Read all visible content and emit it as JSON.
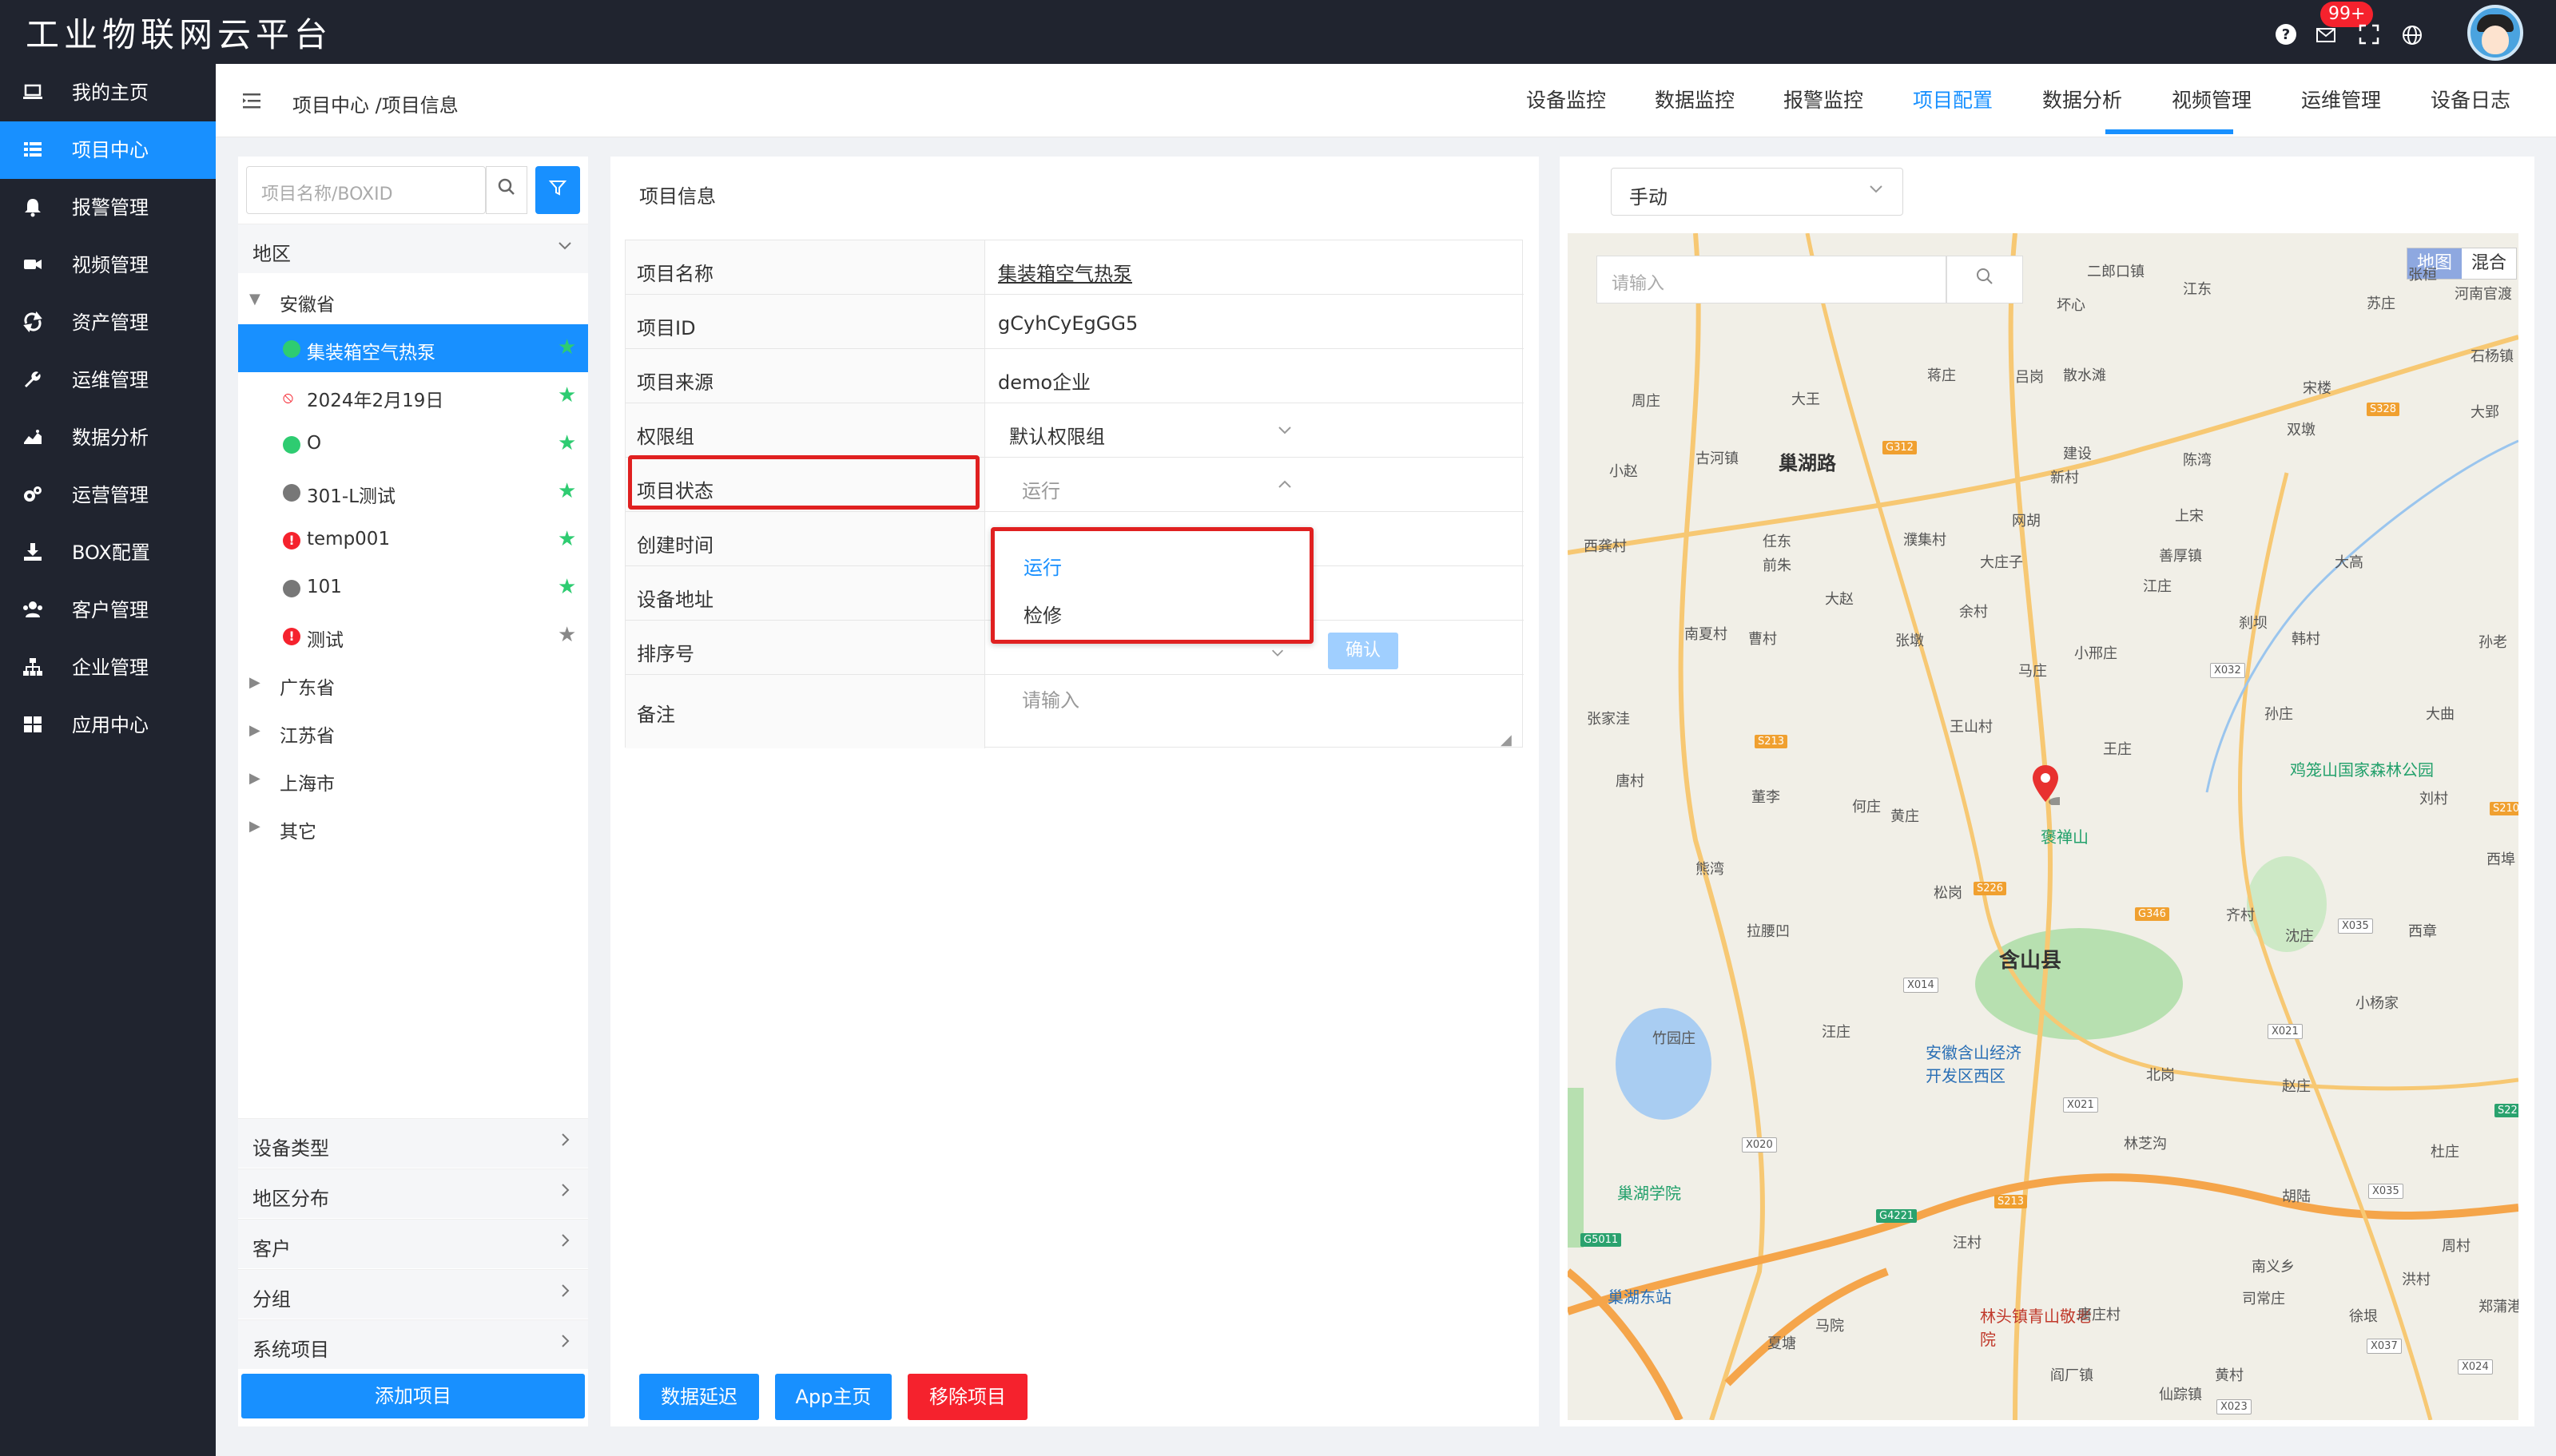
{
  "app": {
    "title": "工业物联网云平台",
    "notification_count": "99+"
  },
  "colors": {
    "accent": "#1890ff",
    "danger": "#f5222d",
    "success": "#2ecc71",
    "sidebar_bg": "#20242f"
  },
  "sidebar": {
    "items": [
      {
        "label": "我的主页",
        "icon": "laptop-icon"
      },
      {
        "label": "项目中心",
        "icon": "list-icon",
        "active": true
      },
      {
        "label": "报警管理",
        "icon": "bell-icon"
      },
      {
        "label": "视频管理",
        "icon": "video-icon"
      },
      {
        "label": "资产管理",
        "icon": "recycle-icon"
      },
      {
        "label": "运维管理",
        "icon": "wrench-icon"
      },
      {
        "label": "数据分析",
        "icon": "chart-icon"
      },
      {
        "label": "运营管理",
        "icon": "gears-icon"
      },
      {
        "label": "BOX配置",
        "icon": "download-icon"
      },
      {
        "label": "客户管理",
        "icon": "users-icon"
      },
      {
        "label": "企业管理",
        "icon": "sitemap-icon"
      },
      {
        "label": "应用中心",
        "icon": "apps-icon"
      }
    ]
  },
  "header": {
    "breadcrumb": "项目中心 /项目信息",
    "tabs": [
      {
        "label": "设备监控"
      },
      {
        "label": "数据监控"
      },
      {
        "label": "报警监控"
      },
      {
        "label": "项目配置",
        "active": true
      },
      {
        "label": "数据分析"
      },
      {
        "label": "视频管理"
      },
      {
        "label": "运维管理"
      },
      {
        "label": "设备日志"
      }
    ]
  },
  "project_list": {
    "search_placeholder": "项目名称/BOXID",
    "region_label": "地区",
    "tree": [
      {
        "label": "安徽省",
        "type": "province",
        "expanded": true
      },
      {
        "label": "集装箱空气热泵",
        "type": "project",
        "status": "online",
        "starred": true,
        "selected": true
      },
      {
        "label": "2024年2月19日",
        "type": "project",
        "status": "offline-link",
        "starred": true
      },
      {
        "label": "O",
        "type": "project",
        "status": "online",
        "starred": true
      },
      {
        "label": "301-L测试",
        "type": "project",
        "status": "gray",
        "starred": true
      },
      {
        "label": "temp001",
        "type": "project",
        "status": "alarm",
        "starred": true
      },
      {
        "label": "101",
        "type": "project",
        "status": "gray",
        "starred": true
      },
      {
        "label": "测试",
        "type": "project",
        "status": "alarm",
        "starred": false
      },
      {
        "label": "广东省",
        "type": "province",
        "expanded": false
      },
      {
        "label": "江苏省",
        "type": "province",
        "expanded": false
      },
      {
        "label": "上海市",
        "type": "province",
        "expanded": false
      },
      {
        "label": "其它",
        "type": "province",
        "expanded": false
      }
    ],
    "filters": [
      {
        "label": "设备类型"
      },
      {
        "label": "地区分布"
      },
      {
        "label": "客户"
      },
      {
        "label": "分组"
      },
      {
        "label": "系统项目"
      }
    ],
    "add_button": "添加项目"
  },
  "project_info": {
    "title": "项目信息",
    "fields": {
      "name": {
        "label": "项目名称",
        "value": "集装箱空气热泵"
      },
      "id": {
        "label": "项目ID",
        "value": "gCyhCyEgGG5"
      },
      "source": {
        "label": "项目来源",
        "value": "demo企业"
      },
      "permission": {
        "label": "权限组",
        "value": "默认权限组"
      },
      "status": {
        "label": "项目状态",
        "value": "运行"
      },
      "created": {
        "label": "创建时间",
        "value": ""
      },
      "address": {
        "label": "设备地址",
        "value": ""
      },
      "order": {
        "label": "排序号",
        "value": ""
      },
      "remark": {
        "label": "备注",
        "placeholder": "请输入"
      }
    },
    "status_options": [
      {
        "label": "运行",
        "selected": true
      },
      {
        "label": "检修"
      }
    ],
    "confirm_label": "确认",
    "buttons": {
      "data_delay": "数据延迟",
      "app_home": "App主页",
      "remove": "移除项目"
    }
  },
  "map_panel": {
    "mode_value": "手动",
    "search_placeholder": "请输入",
    "toggle": {
      "map": "地图",
      "hybrid": "混合"
    },
    "labels": {
      "county": "含山县",
      "road": "巢湖路",
      "park": "褒禅山",
      "forest": "鸡笼山国家森林公园",
      "devzone": "安徽含山经济开发区西区",
      "school": "巢湖学院",
      "station": "巢湖东站",
      "elder": "林头镇青山敬老院",
      "t1": "二郎口镇",
      "t2": "古河镇",
      "t3": "善厚镇",
      "t4": "林头镇",
      "t5": "仙踪镇",
      "v1": "周庄",
      "v2": "大王",
      "v3": "蒋庄",
      "v4": "吕岗",
      "v5": "散水滩",
      "v6": "江东",
      "v7": "苏庄",
      "v8": "石杨镇",
      "v9": "宋楼",
      "v10": "双墩",
      "v11": "大郢",
      "v12": "小赵",
      "v13": "建设",
      "v14": "新村",
      "v15": "陈湾",
      "v16": "西龚村",
      "v17": "任东",
      "v18": "前朱",
      "v19": "濮集村",
      "v20": "大庄子",
      "v21": "网胡",
      "v22": "上宋",
      "v23": "江庄",
      "v24": "大高",
      "v25": "大赵",
      "v26": "余村",
      "v27": "南夏村",
      "v28": "曹村",
      "v29": "张墩",
      "v30": "小邢庄",
      "v31": "刹坝",
      "v32": "韩村",
      "v33": "孙老",
      "v34": "马庄",
      "v35": "张家洼",
      "v36": "王山村",
      "v37": "孙庄",
      "v38": "大曲",
      "v39": "王庄",
      "v40": "唐村",
      "v41": "董李",
      "v42": "何庄",
      "v43": "黄庄",
      "v44": "刘村",
      "v45": "西埠",
      "v46": "熊湾",
      "v47": "松岗",
      "v48": "齐村",
      "v49": "沈庄",
      "v50": "西章",
      "v51": "拉腰凹",
      "v52": "小杨家",
      "v53": "竹园庄",
      "v54": "汪庄",
      "v55": "北岗",
      "v56": "赵庄",
      "v57": "林芝沟",
      "v58": "杜庄",
      "v59": "胡陆",
      "v60": "周村",
      "v61": "汪村",
      "v62": "南义乡",
      "v63": "洪村",
      "v64": "马院",
      "v65": "唐庄村",
      "v66": "司常庄",
      "v67": "徐垠",
      "v68": "夏塘",
      "v69": "阎厂镇",
      "v70": "黄村",
      "v71": "河南官渡",
      "v72": "张桓",
      "v73": "坏心",
      "v74": "郑蒲港"
    },
    "shields": {
      "s1": "S328",
      "s2": "G312",
      "s3": "S213",
      "s4": "X032",
      "s5": "S226",
      "s6": "G346",
      "s7": "X014",
      "s8": "X035",
      "s9": "X021",
      "s10": "X020",
      "s11": "X021",
      "s12": "G4221",
      "s13": "S213",
      "s14": "G5011",
      "s15": "X037",
      "s16": "X024",
      "s17": "X023",
      "s18": "S210",
      "s19": "S22",
      "s20": "X035"
    }
  }
}
